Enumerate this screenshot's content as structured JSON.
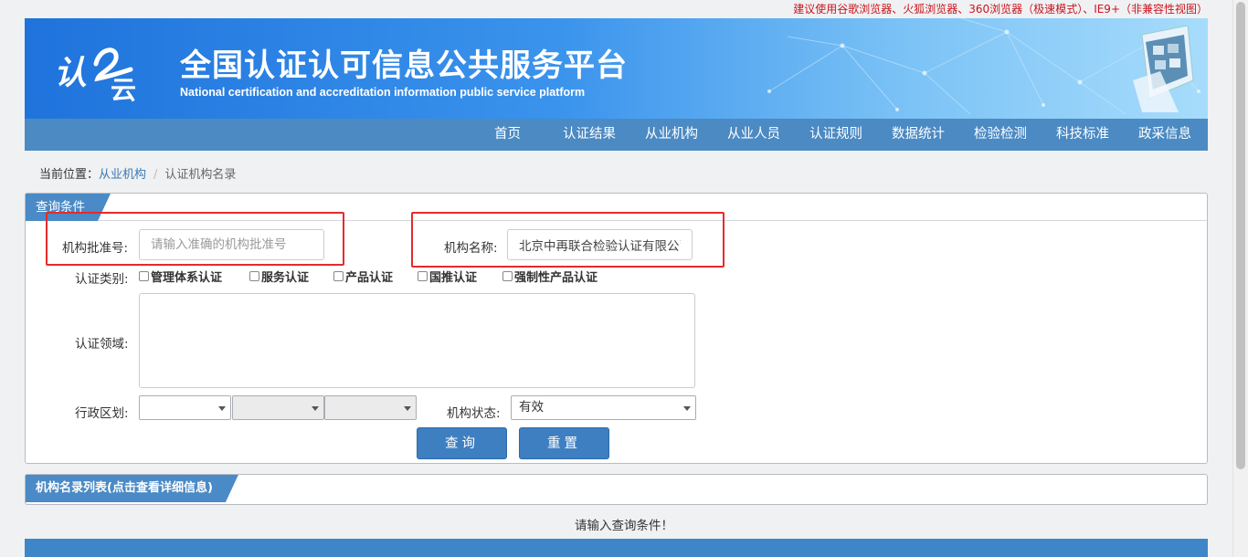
{
  "browser_tip": "建议使用谷歌浏览器、火狐浏览器、360浏览器（极速模式）、IE9+（非兼容性视图）",
  "header": {
    "title": "全国认证认可信息公共服务平台",
    "subtitle": "National certification and accreditation information public service platform",
    "logo_text": "认云"
  },
  "nav": {
    "items": [
      {
        "label": "首页"
      },
      {
        "label": "认证结果"
      },
      {
        "label": "从业机构"
      },
      {
        "label": "从业人员"
      },
      {
        "label": "认证规则"
      },
      {
        "label": "数据统计"
      },
      {
        "label": "检验检测"
      },
      {
        "label": "科技标准"
      },
      {
        "label": "政采信息"
      }
    ]
  },
  "breadcrumb": {
    "prefix": "当前位置：",
    "link": "从业机构",
    "separator": "/",
    "current": "认证机构名录"
  },
  "query_panel": {
    "title": "查询条件",
    "approval_no_label": "机构批准号:",
    "approval_no_placeholder": "请输入准确的机构批准号",
    "approval_no_value": "",
    "org_name_label": "机构名称:",
    "org_name_value": "北京中再联合检验认证有限公司",
    "cert_type_label": "认证类别:",
    "cert_types": [
      {
        "label": "管理体系认证",
        "checked": false
      },
      {
        "label": "服务认证",
        "checked": false
      },
      {
        "label": "产品认证",
        "checked": false
      },
      {
        "label": "国推认证",
        "checked": false
      },
      {
        "label": "强制性产品认证",
        "checked": false
      }
    ],
    "cert_field_label": "认证领域:",
    "region_label": "行政区划:",
    "status_label": "机构状态:",
    "status_value": "有效",
    "query_button": "查询",
    "reset_button": "重置"
  },
  "list_panel": {
    "title": "机构名录列表(点击查看详细信息)",
    "empty_tip": "请输入查询条件！"
  },
  "colors": {
    "nav_bg": "#4b8ac3",
    "accent": "#3e7fc1",
    "highlight": "#e52b2b",
    "tip_red": "#c8161d"
  }
}
